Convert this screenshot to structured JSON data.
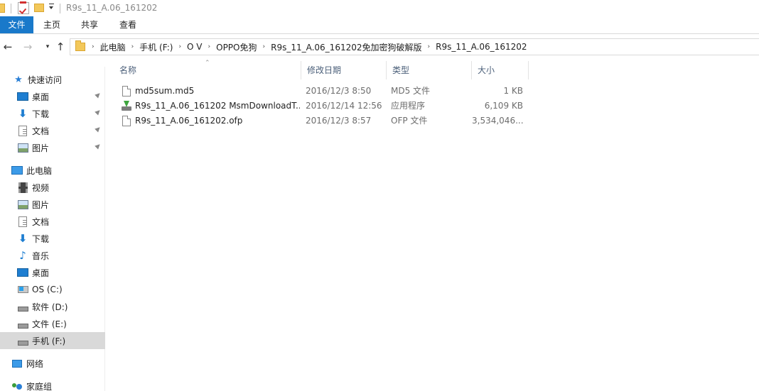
{
  "window": {
    "title": "R9s_11_A.06_161202"
  },
  "ribbon": {
    "tabs": [
      "文件",
      "主页",
      "共享",
      "查看"
    ]
  },
  "address": {
    "crumbs": [
      "此电脑",
      "手机 (F:)",
      "O V",
      "OPPO免狗",
      "R9s_11_A.06_161202免加密狗破解版",
      "R9s_11_A.06_161202"
    ]
  },
  "sidebar": {
    "items": [
      {
        "label": "快速访问",
        "icon": "star-icon"
      },
      {
        "label": "桌面",
        "icon": "desktop-icon",
        "pinned": true
      },
      {
        "label": "下载",
        "icon": "download-icon",
        "pinned": true
      },
      {
        "label": "文档",
        "icon": "document-icon",
        "pinned": true
      },
      {
        "label": "图片",
        "icon": "picture-icon",
        "pinned": true
      },
      {
        "label": "此电脑",
        "icon": "computer-icon"
      },
      {
        "label": "视频",
        "icon": "video-icon"
      },
      {
        "label": "图片",
        "icon": "picture-icon"
      },
      {
        "label": "文档",
        "icon": "document-icon"
      },
      {
        "label": "下载",
        "icon": "download-icon"
      },
      {
        "label": "音乐",
        "icon": "music-icon"
      },
      {
        "label": "桌面",
        "icon": "desktop-icon"
      },
      {
        "label": "OS (C:)",
        "icon": "os-drive-icon"
      },
      {
        "label": "软件 (D:)",
        "icon": "drive-icon"
      },
      {
        "label": "文件 (E:)",
        "icon": "drive-icon"
      },
      {
        "label": "手机 (F:)",
        "icon": "drive-icon",
        "selected": true
      },
      {
        "label": "网络",
        "icon": "network-icon"
      },
      {
        "label": "家庭组",
        "icon": "homegroup-icon"
      }
    ]
  },
  "columns": {
    "name": "名称",
    "date": "修改日期",
    "type": "类型",
    "size": "大小"
  },
  "files": [
    {
      "name": "md5sum.md5",
      "date": "2016/12/3 8:50",
      "type": "MD5 文件",
      "size": "1 KB",
      "icon": "file-icon"
    },
    {
      "name": "R9s_11_A.06_161202 MsmDownloadT...",
      "date": "2016/12/14 12:56",
      "type": "应用程序",
      "size": "6,109 KB",
      "icon": "application-icon"
    },
    {
      "name": "R9s_11_A.06_161202.ofp",
      "date": "2016/12/3 8:57",
      "type": "OFP 文件",
      "size": "3,534,046...",
      "icon": "file-icon"
    }
  ]
}
